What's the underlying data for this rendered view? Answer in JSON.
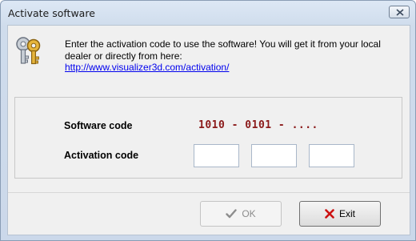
{
  "window": {
    "title": "Activate software"
  },
  "message": {
    "text": "Enter the activation code to use the software! You will get it from your local dealer or directly from here:",
    "link": "http://www.visualizer3d.com/activation/"
  },
  "software_code": {
    "label": "Software code",
    "value": "1010 - 0101 - ...."
  },
  "activation_code": {
    "label": "Activation code",
    "fields": [
      "",
      "",
      ""
    ]
  },
  "buttons": {
    "ok_label": "OK",
    "exit_label": "Exit"
  },
  "colors": {
    "code_color": "#8b1a1a",
    "exit_icon": "#cc1111",
    "link": "#0000ee"
  },
  "icons": {
    "main": "keys-icon",
    "ok": "checkmark-icon",
    "exit": "x-icon",
    "close": "close-icon"
  }
}
